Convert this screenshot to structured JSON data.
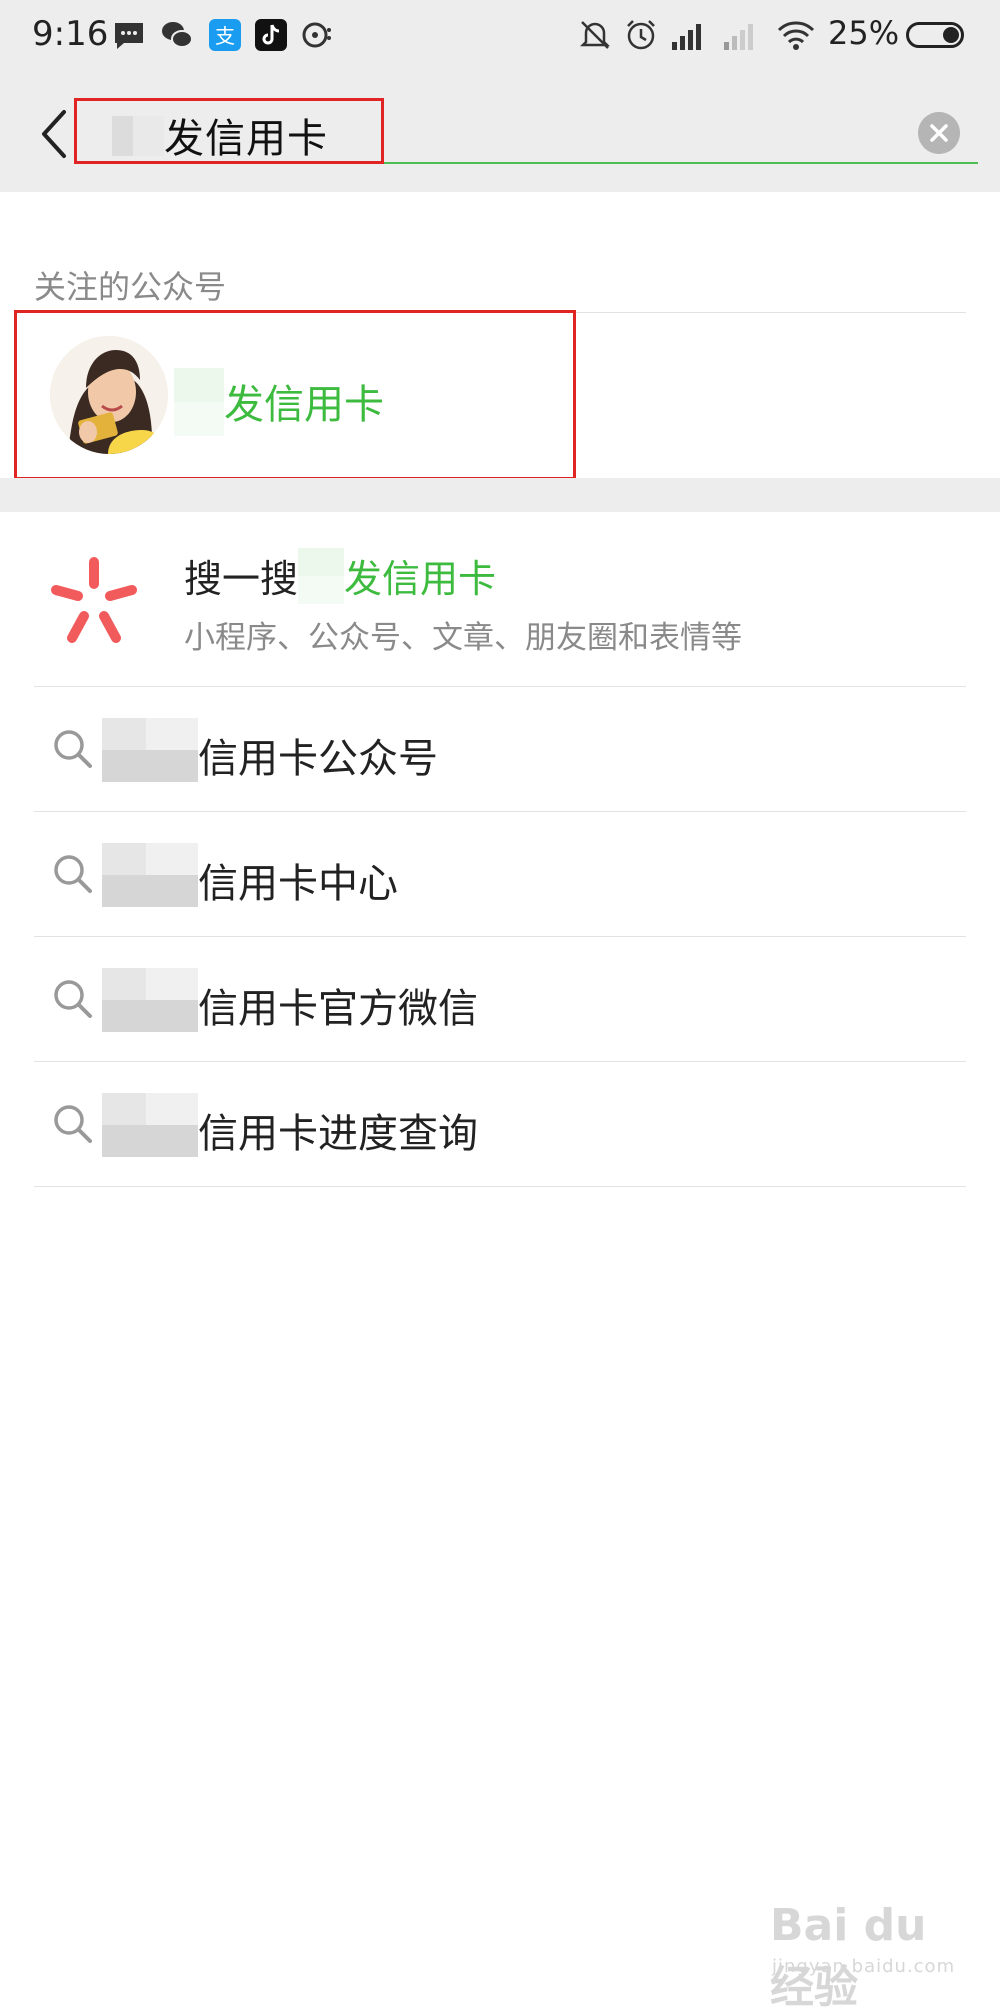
{
  "status_bar": {
    "time": "9:16",
    "battery_percent": "25%",
    "icons": [
      "message-icon",
      "wechat-icon",
      "alipay-icon",
      "tiktok-icon",
      "chat-icon",
      "mute-icon",
      "alarm-icon",
      "signal-icon",
      "signal-weak-icon",
      "wifi-icon",
      "battery-icon"
    ]
  },
  "search": {
    "query_visible": "发信用卡",
    "accent_color": "#4cbf50"
  },
  "followed_section": {
    "label": "关注的公众号",
    "accounts": [
      {
        "name_visible": "发信用卡",
        "avatar": "woman-holding-card-avatar"
      }
    ]
  },
  "sou_yi_sou": {
    "prefix": "搜一搜",
    "query_visible": "发信用卡",
    "subtitle": "小程序、公众号、文章、朋友圈和表情等",
    "icon": "sou-yi-sou-icon",
    "icon_color": "#f25b5b"
  },
  "suggestions": [
    {
      "text": "信用卡公众号"
    },
    {
      "text": "信用卡中心"
    },
    {
      "text": "信用卡官方微信"
    },
    {
      "text": "信用卡进度查询"
    }
  ],
  "watermark": {
    "big": "Bai du 经验",
    "small": "jingyan.baidu.com"
  }
}
